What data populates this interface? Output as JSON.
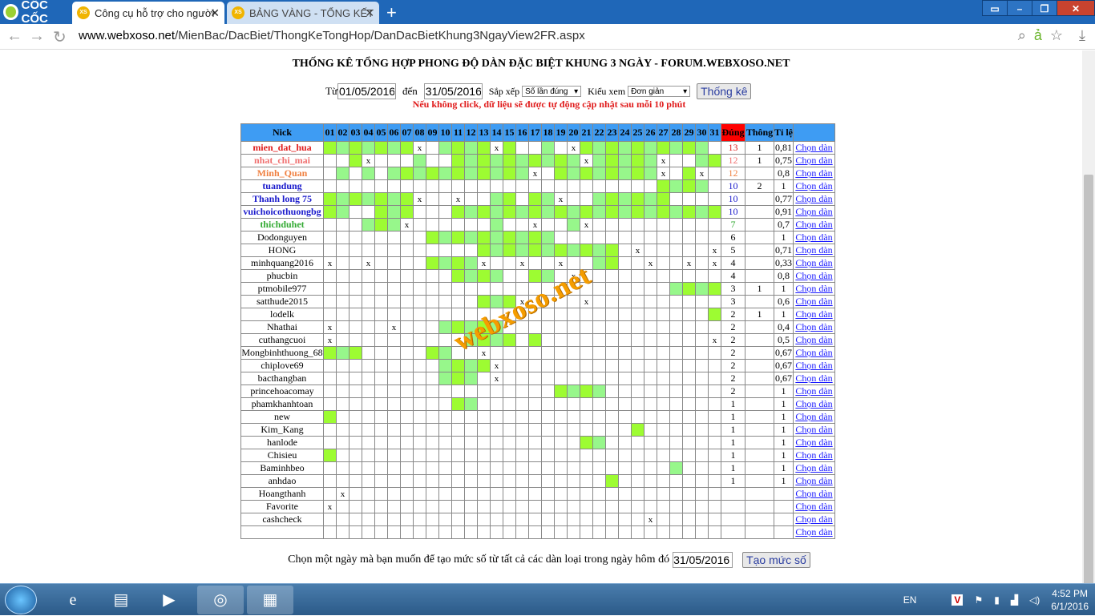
{
  "browser": {
    "brand": "CỐC CỐC",
    "tabs": [
      {
        "label": "Công cụ hỗ trợ cho người",
        "favicon": "XS"
      },
      {
        "label": "BẢNG VÀNG - TỔNG KẾT",
        "favicon": "XS"
      }
    ],
    "url_domain": "www.webxoso.net",
    "url_path": "/MienBac/DacBiet/ThongKeTongHop/DanDacBietKhung3NgayView2FR.aspx"
  },
  "page": {
    "title": "THỐNG KÊ TỔNG HỢP PHONG ĐỘ DÀN ĐẶC BIỆT KHUNG 3 NGÀY - FORUM.WEBXOSO.NET",
    "from_label": "Từ",
    "from_value": "01/05/2016",
    "to_label": "đến",
    "to_value": "31/05/2016",
    "sort_label": "Sắp xếp",
    "sort_value": "Số lần đúng",
    "view_label": "Kiểu xem",
    "view_value": "Đơn giản",
    "stats_button": "Thống kê",
    "note": "Nếu không click, dữ liệu sẽ được tự động cập nhật sau mỗi 10 phút",
    "watermark": "webxoso.net",
    "bottom_label": "Chọn một ngày mà bạn muốn để tạo mức số từ tất cả các dàn loại trong ngày hôm đó",
    "bottom_value": "31/05/2016",
    "bottom_button": "Tạo mức số"
  },
  "table": {
    "headers": {
      "nick": "Nick",
      "days": [
        "01",
        "02",
        "03",
        "04",
        "05",
        "06",
        "07",
        "08",
        "09",
        "10",
        "11",
        "12",
        "13",
        "14",
        "15",
        "16",
        "17",
        "18",
        "19",
        "20",
        "21",
        "22",
        "23",
        "24",
        "25",
        "26",
        "27",
        "28",
        "29",
        "30",
        "31"
      ],
      "dung": "Đúng",
      "thong": "Thông",
      "tile": "Tỉ lệ"
    },
    "link_label": "Chọn dàn",
    "rows": [
      {
        "nick": "mien_dat_hua",
        "color": "#e01b1b",
        "bold": true,
        "cells": "1111111x.1111x1..1.x1111111111",
        "dung": "13",
        "thong": "1",
        "tile": "0,81"
      },
      {
        "nick": "nhat_chi_mai",
        "color": "#f07070",
        "bold": true,
        "cells": "..1x...1..1111111111x11111x..11",
        "dung": "12",
        "thong": "1",
        "tile": "0,75"
      },
      {
        "nick": "Minh_Quan",
        "color": "#f08040",
        "bold": true,
        "cells": ".1.1.11111111111x.11111111x.1x.",
        "dung": "12",
        "thong": "",
        "tile": "0,8"
      },
      {
        "nick": "tuandung",
        "color": "#1a1acc",
        "bold": true,
        "cells": "..........................1111",
        "dung": "10",
        "thong": "2",
        "tile": "1"
      },
      {
        "nick": "Thanh long 75",
        "color": "#1a1acc",
        "bold": true,
        "cells": "1111111x..x..11.11x..111111.....",
        "dung": "10",
        "thong": "",
        "tile": "0,77"
      },
      {
        "nick": "vuichoicothuongbg",
        "color": "#1a1acc",
        "bold": true,
        "cells": "11..111...111111111111111111111x",
        "dung": "10",
        "thong": "",
        "tile": "0,91"
      },
      {
        "nick": "thichduhet",
        "color": "#33aa33",
        "bold": true,
        "cells": "...111x......1..x..1x...........",
        "dung": "7",
        "thong": "",
        "tile": "0,7"
      },
      {
        "nick": "Dodonguyen",
        "color": "#000",
        "bold": false,
        "cells": "........1111111111..............",
        "dung": "6",
        "thong": "",
        "tile": "1"
      },
      {
        "nick": "HONG",
        "color": "#000",
        "bold": false,
        "cells": "............11111111111.x.....x",
        "dung": "5",
        "thong": "",
        "tile": "0,71"
      },
      {
        "nick": "minhquang2016",
        "color": "#000",
        "bold": false,
        "cells": "x..x....1111x..x..x..11..x..x.x",
        "dung": "4",
        "thong": "",
        "tile": "0,33"
      },
      {
        "nick": "phucbin",
        "color": "#000",
        "bold": false,
        "cells": "..........1111..11.x...........",
        "dung": "4",
        "thong": "",
        "tile": "0,8"
      },
      {
        "nick": "ptmobile977",
        "color": "#000",
        "bold": false,
        "cells": "...........................1111",
        "dung": "3",
        "thong": "1",
        "tile": "1"
      },
      {
        "nick": "satthude2015",
        "color": "#000",
        "bold": false,
        "cells": "............111x....x..........",
        "dung": "3",
        "thong": "",
        "tile": "0,6"
      },
      {
        "nick": "lodelk",
        "color": "#000",
        "bold": false,
        "cells": "..............................1",
        "dung": "2",
        "thong": "1",
        "tile": "1"
      },
      {
        "nick": "Nhathai",
        "color": "#000",
        "bold": false,
        "cells": "x....x...11111...................",
        "dung": "2",
        "thong": "",
        "tile": "0,4"
      },
      {
        "nick": "cuthangcuoi",
        "color": "#000",
        "bold": false,
        "cells": "x..........1111.1.............x",
        "dung": "2",
        "thong": "",
        "tile": "0,5"
      },
      {
        "nick": "Mongbinhthuong_68",
        "color": "#000",
        "bold": false,
        "cells": "111.....11..x..................",
        "dung": "2",
        "thong": "",
        "tile": "0,67"
      },
      {
        "nick": "chiplove69",
        "color": "#000",
        "bold": false,
        "cells": ".........1111x.................",
        "dung": "2",
        "thong": "",
        "tile": "0,67"
      },
      {
        "nick": "bacthangban",
        "color": "#000",
        "bold": false,
        "cells": ".........111.x..................",
        "dung": "2",
        "thong": "",
        "tile": "0,67"
      },
      {
        "nick": "princehoacomay",
        "color": "#000",
        "bold": false,
        "cells": "..................1111.........",
        "dung": "2",
        "thong": "",
        "tile": "1"
      },
      {
        "nick": "phamkhanhtoan",
        "color": "#000",
        "bold": false,
        "cells": "..........11...................",
        "dung": "1",
        "thong": "",
        "tile": "1"
      },
      {
        "nick": "new",
        "color": "#000",
        "bold": false,
        "cells": "1..............................",
        "dung": "1",
        "thong": "",
        "tile": "1"
      },
      {
        "nick": "Kim_Kang",
        "color": "#000",
        "bold": false,
        "cells": "........................1......",
        "dung": "1",
        "thong": "",
        "tile": "1"
      },
      {
        "nick": "hanlode",
        "color": "#000",
        "bold": false,
        "cells": "....................11.........",
        "dung": "1",
        "thong": "",
        "tile": "1"
      },
      {
        "nick": "Chisieu",
        "color": "#000",
        "bold": false,
        "cells": "1..............................",
        "dung": "1",
        "thong": "",
        "tile": "1"
      },
      {
        "nick": "Baminhbeo",
        "color": "#000",
        "bold": false,
        "cells": "...........................1...",
        "dung": "1",
        "thong": "",
        "tile": "1"
      },
      {
        "nick": "anhdao",
        "color": "#000",
        "bold": false,
        "cells": "......................1........",
        "dung": "1",
        "thong": "",
        "tile": "1"
      },
      {
        "nick": "Hoangthanh",
        "color": "#000",
        "bold": false,
        "cells": ".x.............................",
        "dung": "",
        "thong": "",
        "tile": ""
      },
      {
        "nick": "Favorite",
        "color": "#000",
        "bold": false,
        "cells": "x..............................",
        "dung": "",
        "thong": "",
        "tile": ""
      },
      {
        "nick": "cashcheck",
        "color": "#000",
        "bold": false,
        "cells": ".........................x.....",
        "dung": "",
        "thong": "",
        "tile": ""
      },
      {
        "nick": "",
        "color": "#000",
        "bold": false,
        "cells": "...............................",
        "dung": "",
        "thong": "",
        "tile": ""
      }
    ]
  },
  "taskbar": {
    "lang": "EN",
    "time": "4:52 PM",
    "date": "6/1/2016"
  }
}
